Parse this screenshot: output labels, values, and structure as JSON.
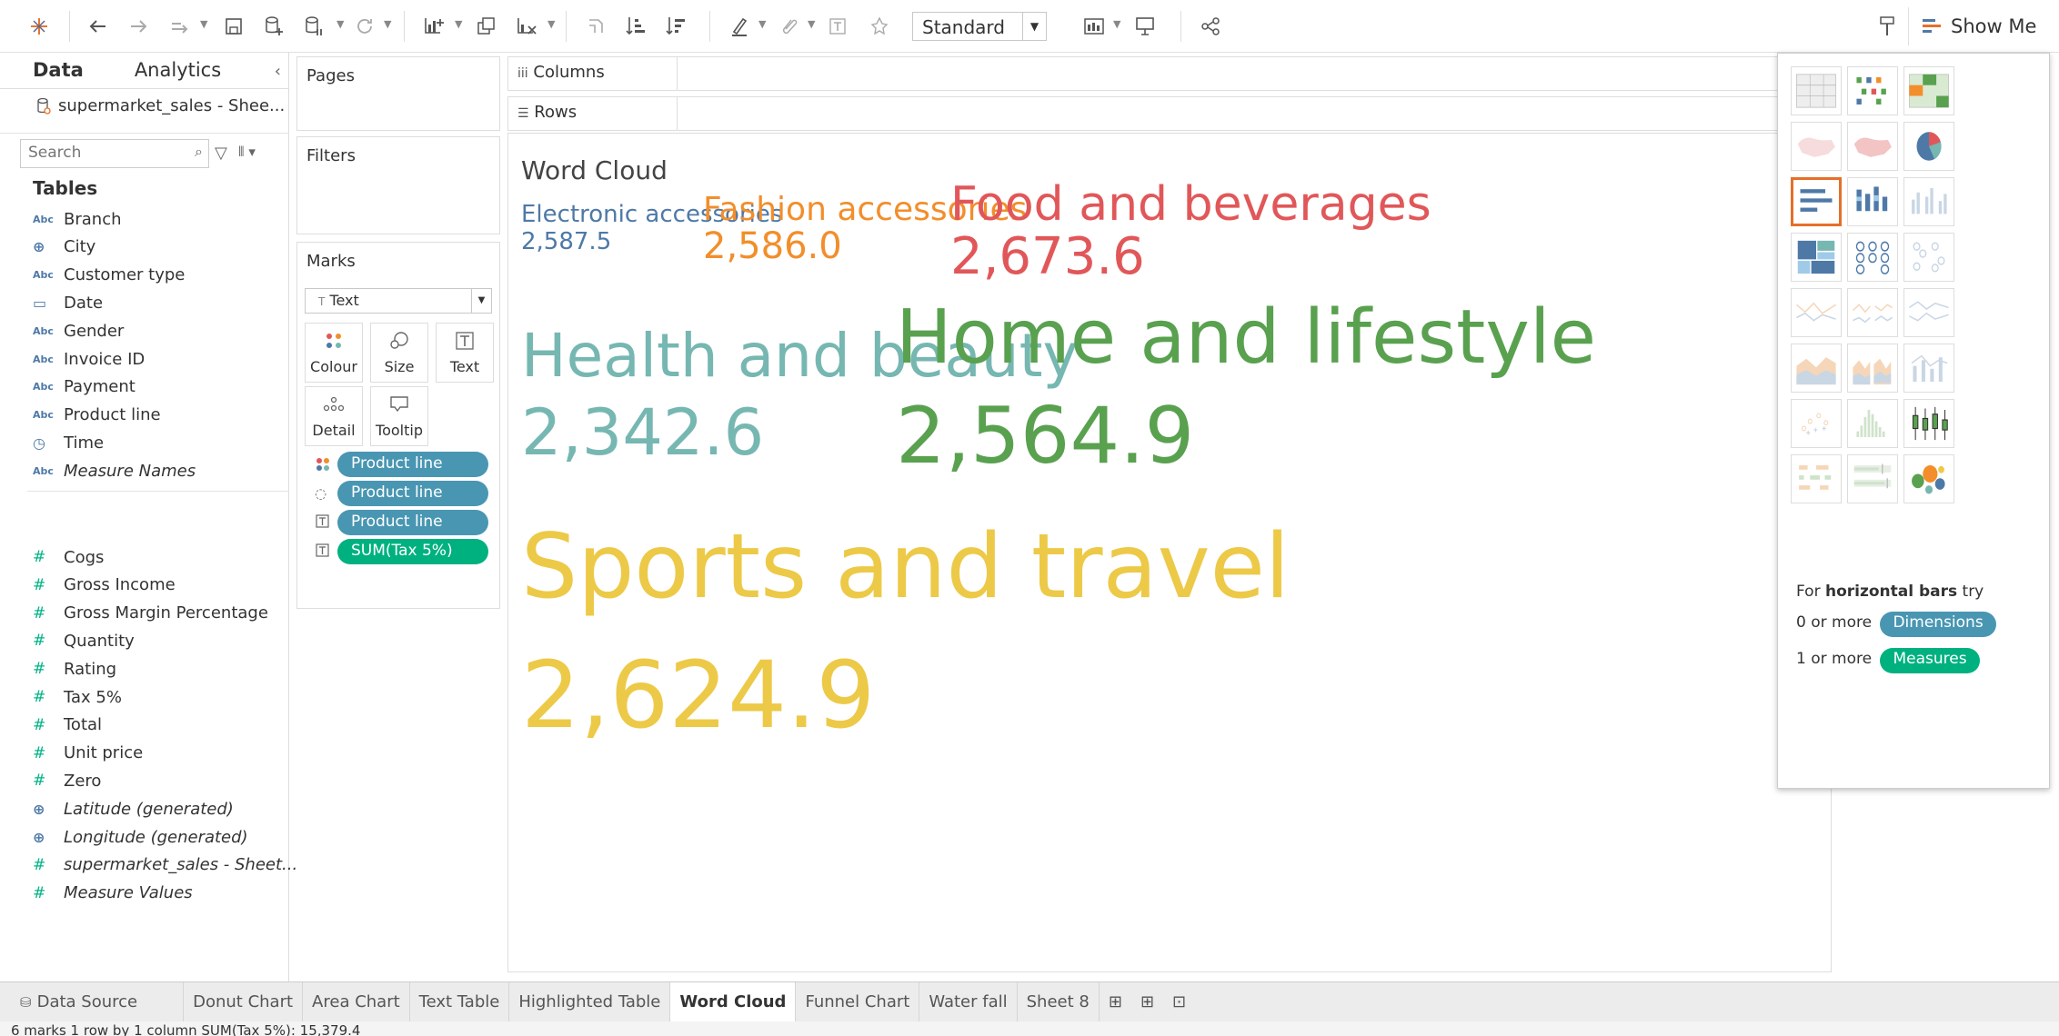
{
  "toolbar": {
    "view_mode": "Standard",
    "show_me_label": "Show Me"
  },
  "data_pane": {
    "tab_data": "Data",
    "tab_analytics": "Analytics",
    "datasource": "supermarket_sales - Shee...",
    "search_placeholder": "Search",
    "tables_heading": "Tables",
    "dimensions": [
      {
        "label": "Branch",
        "icon": "abc-icon"
      },
      {
        "label": "City",
        "icon": "globe-icon"
      },
      {
        "label": "Customer type",
        "icon": "abc-icon"
      },
      {
        "label": "Date",
        "icon": "calendar-icon"
      },
      {
        "label": "Gender",
        "icon": "abc-icon"
      },
      {
        "label": "Invoice ID",
        "icon": "abc-icon"
      },
      {
        "label": "Payment",
        "icon": "abc-icon"
      },
      {
        "label": "Product line",
        "icon": "abc-icon"
      },
      {
        "label": "Time",
        "icon": "datetime-icon"
      },
      {
        "label": "Measure Names",
        "icon": "abc-icon"
      }
    ],
    "measures": [
      {
        "label": "Cogs"
      },
      {
        "label": "Gross Income"
      },
      {
        "label": "Gross Margin Percentage"
      },
      {
        "label": "Quantity"
      },
      {
        "label": "Rating"
      },
      {
        "label": "Tax 5%"
      },
      {
        "label": "Total"
      },
      {
        "label": "Unit price"
      },
      {
        "label": "Zero"
      },
      {
        "label": "Latitude (generated)"
      },
      {
        "label": "Longitude (generated)"
      },
      {
        "label": "supermarket_sales - Sheet..."
      },
      {
        "label": "Measure Values"
      }
    ]
  },
  "shelves": {
    "pages": "Pages",
    "filters": "Filters",
    "marks": "Marks",
    "mark_type": "Text",
    "columns": "Columns",
    "rows": "Rows",
    "mark_buttons": {
      "colour": "Colour",
      "size": "Size",
      "text": "Text",
      "detail": "Detail",
      "tooltip": "Tooltip"
    },
    "mark_pills": [
      "Product line",
      "Product line",
      "Product line",
      "SUM(Tax 5%)"
    ]
  },
  "worksheet": {
    "title": "Word Cloud",
    "words": [
      {
        "label": "Electronic accessories",
        "value": "2,587.5",
        "color": "#4e79a7"
      },
      {
        "label": "Fashion accessories",
        "value": "2,586.0",
        "color": "#f28e2b"
      },
      {
        "label": "Food and beverages",
        "value": "2,673.6",
        "color": "#e15759"
      },
      {
        "label": "Health and beauty",
        "value": "2,342.6",
        "color": "#76b7b2"
      },
      {
        "label": "Home and lifestyle",
        "value": "2,564.9",
        "color": "#59a14f"
      },
      {
        "label": "Sports and travel",
        "value": "2,624.9",
        "color": "#edc948"
      }
    ]
  },
  "show_me": {
    "hint_prefix": "For",
    "hint_chart": "horizontal bars",
    "hint_suffix": "try",
    "dim_prefix": "0 or more",
    "dim_pill": "Dimensions",
    "meas_prefix": "1 or more",
    "meas_pill": "Measures",
    "colors": {
      "dimension": "#4996b2",
      "measure": "#00b180",
      "selected": "#e5702a"
    }
  },
  "sheet_tabs": {
    "data_source": "Data Source",
    "tabs": [
      "Donut Chart",
      "Area Chart",
      "Text Table",
      "Highlighted Table",
      "Word Cloud",
      "Funnel Chart",
      "Water fall",
      "Sheet 8"
    ],
    "active": "Word Cloud"
  },
  "status": {
    "text": "6 marks    1 row by 1 column    SUM(Tax 5%): 15,379.4"
  }
}
